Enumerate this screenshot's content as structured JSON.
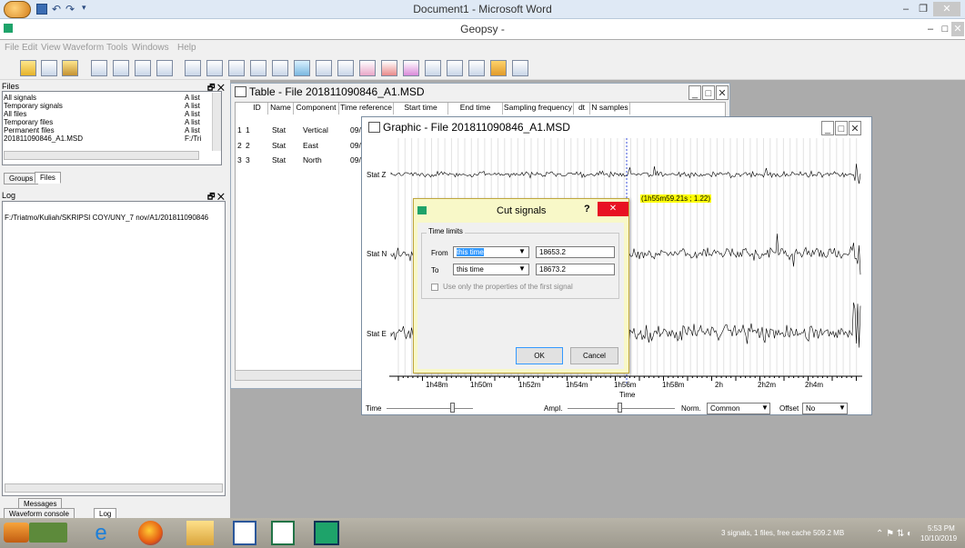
{
  "word": {
    "title": "Document1 - Microsoft Word"
  },
  "app": {
    "title": "Geopsy -"
  },
  "menu": [
    "File",
    "Edit",
    "View",
    "Waveform",
    "Tools",
    "Windows",
    "Help"
  ],
  "files_panel": {
    "title": "Files",
    "items": [
      {
        "name": "All signals",
        "value": "A list"
      },
      {
        "name": "Temporary signals",
        "value": "A list"
      },
      {
        "name": "All files",
        "value": "A list"
      },
      {
        "name": "Temporary files",
        "value": "A list"
      },
      {
        "name": "Permanent files",
        "value": "A list"
      },
      {
        "name": "201811090846_A1.MSD",
        "value": "F:/Tri"
      }
    ],
    "tabs": [
      "Groups",
      "Files"
    ]
  },
  "log_panel": {
    "title": "Log",
    "path": "F:/Triatmo/Kuliah/SKRIPSI COY/UNY_7 nov/A1/201811090846",
    "tabs": [
      "Messages",
      "Waveform console",
      "Log"
    ]
  },
  "table_window": {
    "title": "Table - File 201811090846_A1.MSD",
    "columns": [
      "ID",
      "Name",
      "Component",
      "Time reference",
      "Start time",
      "End time",
      "Sampling frequency",
      "dt",
      "N samples"
    ],
    "rows": [
      {
        "idx": "1",
        "id": "1",
        "name": "Stat",
        "component": "Vertical",
        "timeref": "09/"
      },
      {
        "idx": "2",
        "id": "2",
        "name": "Stat",
        "component": "East",
        "timeref": "09/"
      },
      {
        "idx": "3",
        "id": "3",
        "name": "Stat",
        "component": "North",
        "timeref": "09/"
      }
    ]
  },
  "graphic_window": {
    "title": "Graphic - File 201811090846_A1.MSD",
    "traces": [
      "Stat Z",
      "Stat N",
      "Stat E"
    ],
    "cursor_label": "(1h55m59.21s ; 1.22)",
    "x_ticks": [
      "1h48m",
      "1h50m",
      "1h52m",
      "1h54m",
      "1h56m",
      "1h58m",
      "2h",
      "2h2m",
      "2h4m"
    ],
    "x_axis_label": "Time",
    "controls": {
      "time_label": "Time",
      "ampl_label": "Ampl.",
      "norm_label": "Norm.",
      "norm_value": "Common",
      "offset_label": "Offset",
      "offset_value": "No"
    }
  },
  "dialog": {
    "title": "Cut signals",
    "help": "?",
    "group_label": "Time limits",
    "from_label": "From",
    "from_mode": "this time",
    "from_value": "18653.2",
    "to_label": "To",
    "to_mode": "this time",
    "to_value": "18673.2",
    "checkbox_label": "Use only the properties of the first signal",
    "ok": "OK",
    "cancel": "Cancel"
  },
  "taskbar": {
    "status": "3 signals, 1 files, free cache 509.2 MB",
    "time": "5:53 PM",
    "date": "10/10/2019"
  },
  "colors": {
    "accent": "#3399ff",
    "close_red": "#e81123",
    "dialog_bg": "#f8f8c8",
    "cursor_label_bg": "#ffff00"
  }
}
